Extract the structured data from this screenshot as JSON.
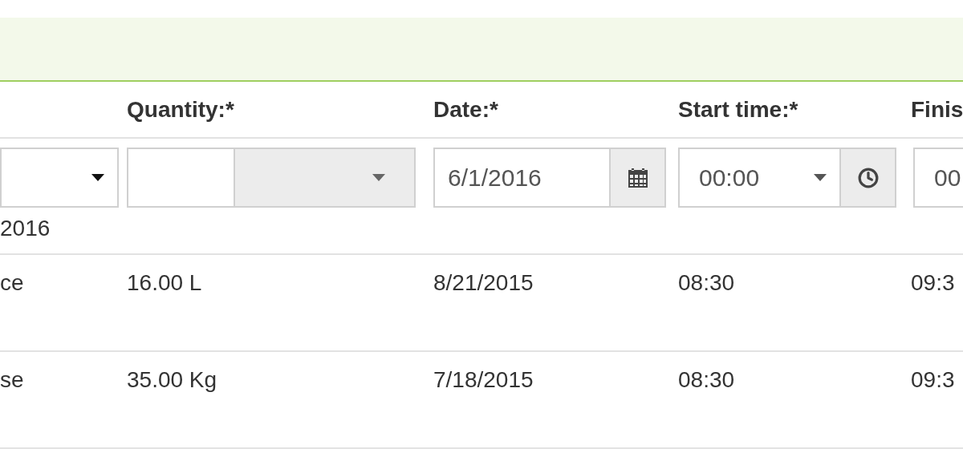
{
  "columns": [
    {},
    {
      "label": "Quantity:*"
    },
    {
      "label": "Date:*"
    },
    {
      "label": "Start time:*"
    },
    {
      "label": "Finis"
    }
  ],
  "filters": [
    {
      "kind": "select",
      "note": "2016"
    },
    {
      "kind": "quantity"
    },
    {
      "kind": "date",
      "value": "6/1/2016"
    },
    {
      "kind": "time",
      "value": "00:00"
    },
    {
      "kind": "plain",
      "value": "00"
    }
  ],
  "rows": [
    [
      "ce",
      "16.00 L",
      "8/21/2015",
      "08:30",
      "09:3"
    ],
    [
      "se",
      "35.00 Kg",
      "7/18/2015",
      "08:30",
      "09:3"
    ]
  ]
}
